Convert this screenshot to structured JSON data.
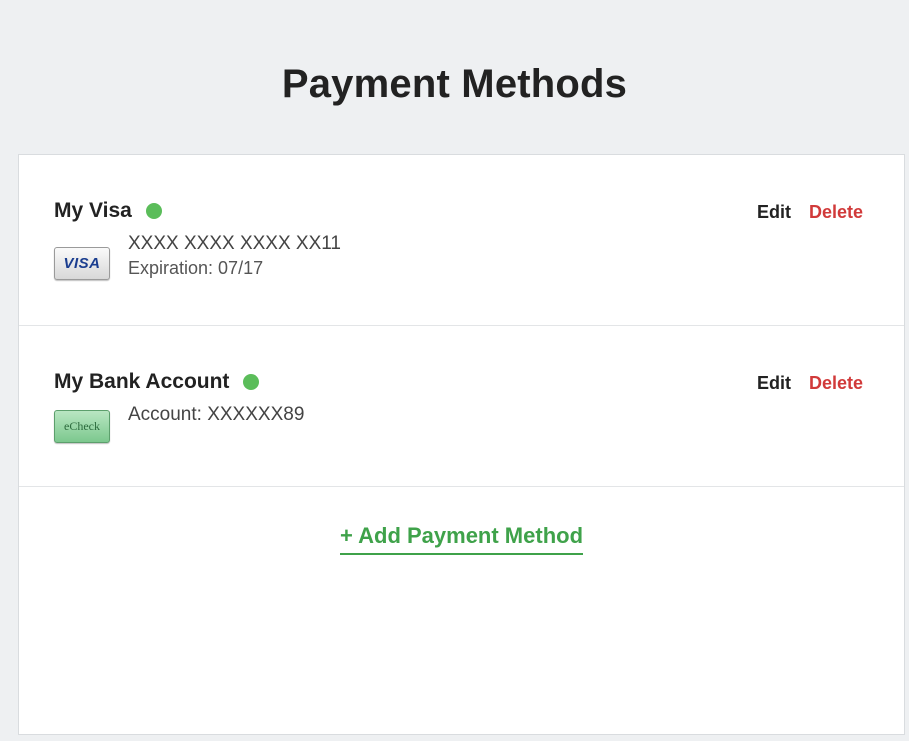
{
  "page": {
    "title": "Payment Methods"
  },
  "colors": {
    "status_active": "#5bbd5a",
    "delete": "#d13a3a",
    "add_link": "#3fa24a"
  },
  "methods": [
    {
      "name": "My Visa",
      "icon": "visa-card-icon",
      "icon_text": "VISA",
      "line1": "XXXX XXXX XXXX XX11",
      "line2": "Expiration: 07/17",
      "edit_label": "Edit",
      "delete_label": "Delete"
    },
    {
      "name": "My Bank Account",
      "icon": "echeck-icon",
      "icon_text": "eCheck",
      "line1": "Account: XXXXXX89",
      "edit_label": "Edit",
      "delete_label": "Delete"
    }
  ],
  "add_label": "+ Add Payment Method"
}
